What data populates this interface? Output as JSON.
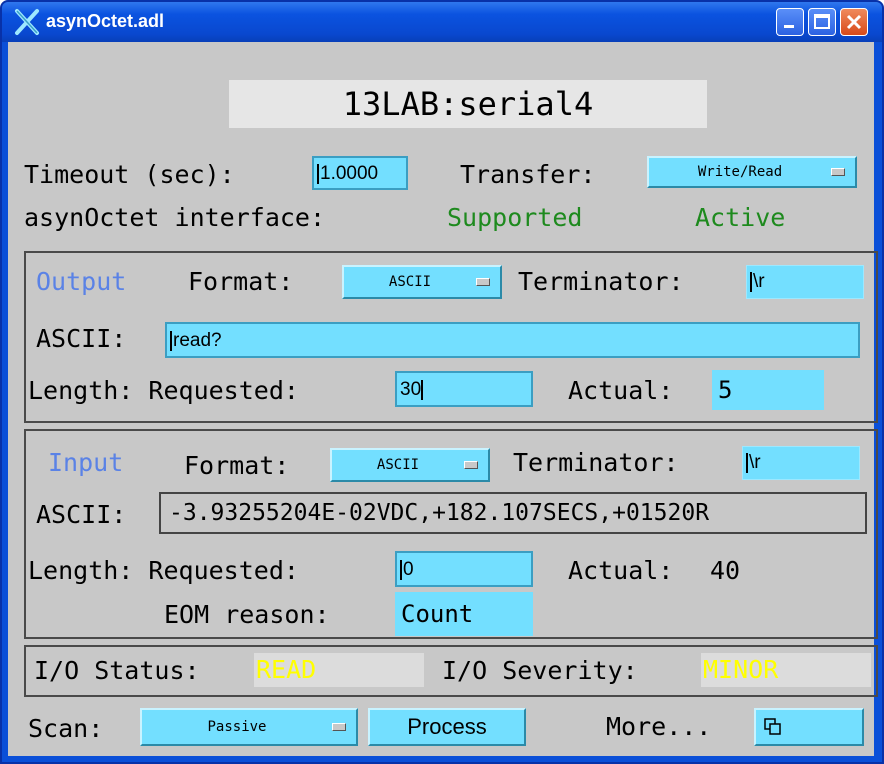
{
  "window": {
    "title": "asynOctet.adl"
  },
  "header": {
    "pv_name": "13LAB:serial4"
  },
  "settings": {
    "timeout_label": "Timeout (sec):",
    "timeout_value": "1.0000",
    "transfer_label": "Transfer:",
    "transfer_value": "Write/Read",
    "interface_label": "asynOctet interface:",
    "supported": "Supported",
    "active": "Active"
  },
  "output": {
    "title": "Output",
    "format_label": "Format:",
    "format_value": "ASCII",
    "terminator_label": "Terminator:",
    "terminator_value": "\\r",
    "ascii_label": "ASCII:",
    "ascii_value": "read?",
    "length_label": "Length: Requested:",
    "requested_value": "30",
    "actual_label": "Actual:",
    "actual_value": "5"
  },
  "input": {
    "title": "Input",
    "format_label": "Format:",
    "format_value": "ASCII",
    "terminator_label": "Terminator:",
    "terminator_value": "\\r",
    "ascii_label": "ASCII:",
    "ascii_value": "-3.93255204E-02VDC,+182.107SECS,+01520R",
    "length_label": "Length: Requested:",
    "requested_value": "0",
    "actual_label": "Actual:",
    "actual_value": "40",
    "eom_label": "EOM reason:",
    "eom_value": "Count"
  },
  "status": {
    "io_status_label": "I/O Status:",
    "io_status_value": "READ",
    "io_severity_label": "I/O Severity:",
    "io_severity_value": "MINOR"
  },
  "footer": {
    "scan_label": "Scan:",
    "scan_value": "Passive",
    "process_label": "Process",
    "more_label": "More...",
    "more_icon": "windows-related-icon"
  },
  "colors": {
    "titlebar": "#0b53e0",
    "background": "#c8c8c8",
    "field": "#73dfff",
    "green_text": "#1e8a1e",
    "blue_text": "#5a82e6",
    "alarm_text": "#ffff00"
  }
}
